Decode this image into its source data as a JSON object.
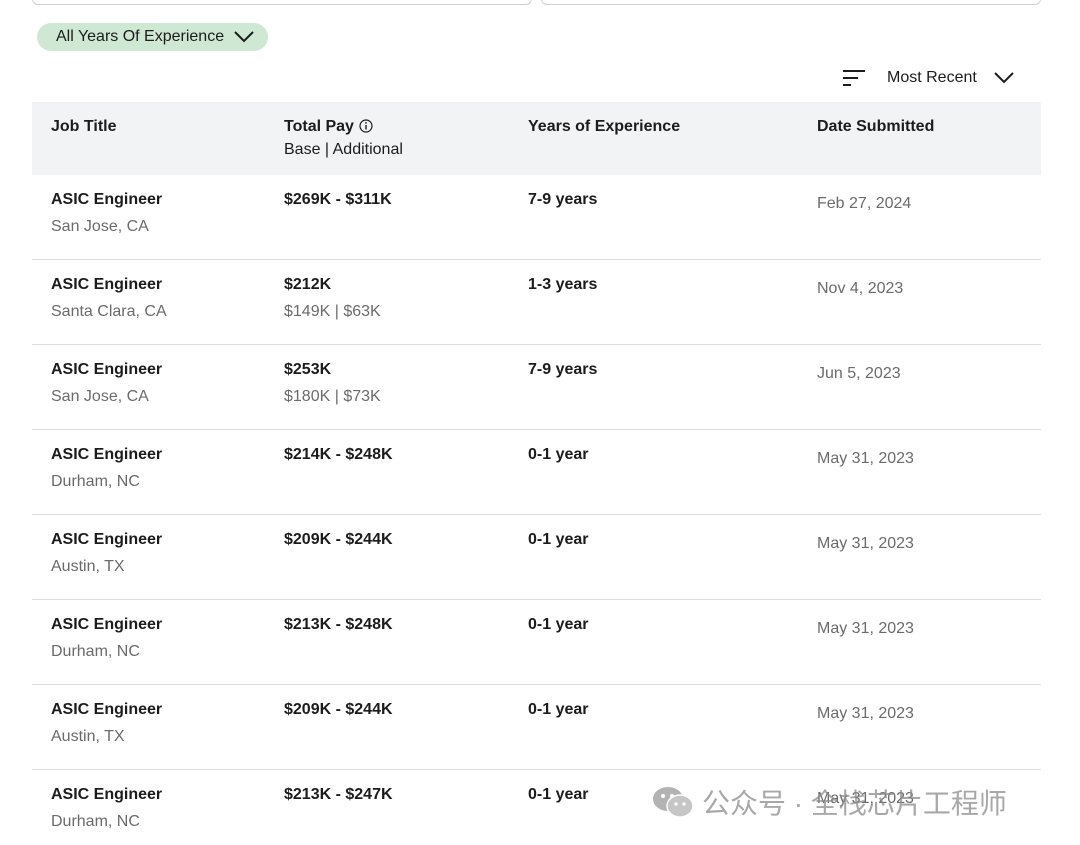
{
  "filters": {
    "experience_chip": "All Years Of Experience",
    "sort_label": "Most Recent"
  },
  "table": {
    "headers": {
      "job_title": "Job Title",
      "total_pay": "Total Pay",
      "total_pay_sub": "Base | Additional",
      "years": "Years of Experience",
      "date": "Date Submitted"
    },
    "rows": [
      {
        "title": "ASIC Engineer",
        "location": "San Jose, CA",
        "pay": "$269K - $311K",
        "breakdown": "",
        "years": "7-9 years",
        "date": "Feb 27, 2024"
      },
      {
        "title": "ASIC Engineer",
        "location": "Santa Clara, CA",
        "pay": "$212K",
        "breakdown": "$149K | $63K",
        "years": "1-3 years",
        "date": "Nov 4, 2023"
      },
      {
        "title": "ASIC Engineer",
        "location": "San Jose, CA",
        "pay": "$253K",
        "breakdown": "$180K | $73K",
        "years": "7-9 years",
        "date": "Jun 5, 2023"
      },
      {
        "title": "ASIC Engineer",
        "location": "Durham, NC",
        "pay": "$214K - $248K",
        "breakdown": "",
        "years": "0-1 year",
        "date": "May 31, 2023"
      },
      {
        "title": "ASIC Engineer",
        "location": "Austin, TX",
        "pay": "$209K - $244K",
        "breakdown": "",
        "years": "0-1 year",
        "date": "May 31, 2023"
      },
      {
        "title": "ASIC Engineer",
        "location": "Durham, NC",
        "pay": "$213K - $248K",
        "breakdown": "",
        "years": "0-1 year",
        "date": "May 31, 2023"
      },
      {
        "title": "ASIC Engineer",
        "location": "Austin, TX",
        "pay": "$209K - $244K",
        "breakdown": "",
        "years": "0-1 year",
        "date": "May 31, 2023"
      },
      {
        "title": "ASIC Engineer",
        "location": "Durham, NC",
        "pay": "$213K - $247K",
        "breakdown": "",
        "years": "0-1 year",
        "date": "May 31, 2023"
      }
    ]
  },
  "watermark": {
    "text": "公众号 · 全栈芯片工程师"
  },
  "icons": {
    "chip_chevron": "chevron-down-icon",
    "sort": "sort-lines-icon",
    "sort_chevron": "chevron-down-icon",
    "info": "info-icon",
    "watermark": "wechat-icon"
  },
  "colors": {
    "chip_bg": "#cfe8d3",
    "header_bg": "#f2f3f4",
    "secondary_text": "#6b6b6b",
    "divider": "#dddddd"
  }
}
